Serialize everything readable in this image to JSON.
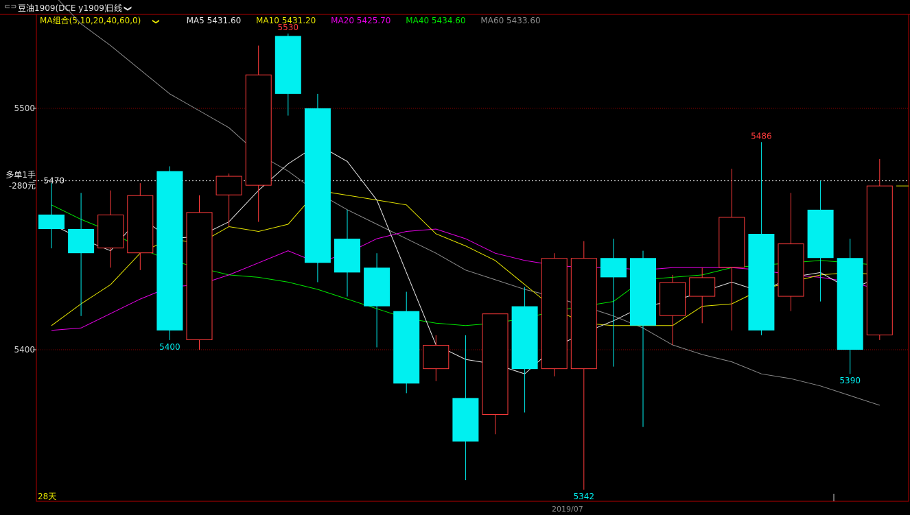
{
  "title_bar": {
    "symbol": "豆油1909(DCE y1909)",
    "period": "日线",
    "chevron": "❯"
  },
  "legend": {
    "group_label": "MA组合(5,10,20,40,60,0)",
    "items": [
      {
        "name": "MA5",
        "text": "MA5 5431.60",
        "color": "#e6e6e6"
      },
      {
        "name": "MA10",
        "text": "MA10 5431.20",
        "color": "#e6e600"
      },
      {
        "name": "MA20",
        "text": "MA20 5425.70",
        "color": "#e600e6"
      },
      {
        "name": "MA40",
        "text": "MA40 5434.60",
        "color": "#00e600"
      },
      {
        "name": "MA60",
        "text": "MA60 5433.60",
        "color": "#8c8c8c"
      }
    ]
  },
  "order": {
    "line1": "多单1手",
    "line2": "-280元",
    "price": "5470"
  },
  "days_label": "28天",
  "date_label": "2019/07",
  "colors": {
    "up": "#ff3b3b",
    "down": "#00f0f0",
    "grid": "#8c0000",
    "border": "#b40000"
  },
  "chart_data": {
    "type": "candlestick",
    "ylim": [
      5334,
      5560
    ],
    "y_ticks": [
      5400,
      5500
    ],
    "annotations": [
      {
        "text": "5530",
        "candle": 8,
        "at": "high"
      },
      {
        "text": "5400",
        "candle": 4,
        "at": "low"
      },
      {
        "text": "5342",
        "candle": 18,
        "at": "low"
      },
      {
        "text": "5486",
        "candle": 24,
        "at": "high"
      },
      {
        "text": "5390",
        "candle": 27,
        "at": "low"
      }
    ],
    "candles": [
      {
        "o": 5456,
        "h": 5469,
        "l": 5442,
        "c": 5450
      },
      {
        "o": 5450,
        "h": 5465,
        "l": 5414,
        "c": 5440
      },
      {
        "o": 5442,
        "h": 5466,
        "l": 5434,
        "c": 5456
      },
      {
        "o": 5440,
        "h": 5469,
        "l": 5433,
        "c": 5464
      },
      {
        "o": 5474,
        "h": 5476,
        "l": 5404,
        "c": 5408
      },
      {
        "o": 5404,
        "h": 5464,
        "l": 5400,
        "c": 5457
      },
      {
        "o": 5464,
        "h": 5473,
        "l": 5451,
        "c": 5472
      },
      {
        "o": 5468,
        "h": 5526,
        "l": 5453,
        "c": 5514
      },
      {
        "o": 5530,
        "h": 5531,
        "l": 5497,
        "c": 5506
      },
      {
        "o": 5500,
        "h": 5506,
        "l": 5428,
        "c": 5436
      },
      {
        "o": 5446,
        "h": 5458,
        "l": 5422,
        "c": 5432
      },
      {
        "o": 5434,
        "h": 5440,
        "l": 5401,
        "c": 5418
      },
      {
        "o": 5416,
        "h": 5424,
        "l": 5382,
        "c": 5386
      },
      {
        "o": 5392,
        "h": 5406,
        "l": 5387,
        "c": 5402
      },
      {
        "o": 5380,
        "h": 5406,
        "l": 5346,
        "c": 5362
      },
      {
        "o": 5373,
        "h": 5410,
        "l": 5365,
        "c": 5415
      },
      {
        "o": 5418,
        "h": 5426,
        "l": 5374,
        "c": 5392
      },
      {
        "o": 5392,
        "h": 5440,
        "l": 5389,
        "c": 5438
      },
      {
        "o": 5392,
        "h": 5445,
        "l": 5342,
        "c": 5438
      },
      {
        "o": 5438,
        "h": 5446,
        "l": 5393,
        "c": 5430
      },
      {
        "o": 5438,
        "h": 5441,
        "l": 5368,
        "c": 5410
      },
      {
        "o": 5414,
        "h": 5431,
        "l": 5402,
        "c": 5428
      },
      {
        "o": 5422,
        "h": 5434,
        "l": 5411,
        "c": 5430
      },
      {
        "o": 5434,
        "h": 5475,
        "l": 5408,
        "c": 5455
      },
      {
        "o": 5448,
        "h": 5486,
        "l": 5406,
        "c": 5408
      },
      {
        "o": 5422,
        "h": 5465,
        "l": 5416,
        "c": 5444
      },
      {
        "o": 5458,
        "h": 5470,
        "l": 5420,
        "c": 5438
      },
      {
        "o": 5438,
        "h": 5446,
        "l": 5390,
        "c": 5400
      },
      {
        "o": 5406,
        "h": 5479,
        "l": 5404,
        "c": 5468
      }
    ],
    "ma": {
      "MA5": [
        5452,
        5446,
        5441,
        5455,
        5446,
        5447,
        5453,
        5466,
        5477,
        5485,
        5478,
        5462,
        5432,
        5402,
        5396,
        5394,
        5390,
        5401,
        5407,
        5412,
        5418,
        5420,
        5424,
        5428,
        5424,
        5430,
        5432,
        5425,
        5430
      ],
      "MA10": [
        5410,
        5419,
        5427,
        5440,
        5446,
        5444,
        5451,
        5449,
        5452,
        5466,
        5464,
        5462,
        5460,
        5448,
        5443,
        5437,
        5427,
        5417,
        5411,
        5410,
        5410,
        5410,
        5418,
        5419,
        5425,
        5428,
        5431,
        5432,
        5431
      ],
      "MA20": [
        5408,
        5409,
        5415,
        5421,
        5426,
        5427,
        5431,
        5436,
        5441,
        5436,
        5440,
        5446,
        5449,
        5450,
        5446,
        5440,
        5437,
        5435,
        5434,
        5434,
        5433,
        5434,
        5434,
        5434,
        5433,
        5431,
        5430,
        5428,
        5425
      ],
      "MA40": [
        5460,
        5454,
        5449,
        5442,
        5437,
        5434,
        5431,
        5430,
        5428,
        5425,
        5421,
        5417,
        5413,
        5411,
        5410,
        5411,
        5413,
        5416,
        5418,
        5420,
        5429,
        5430,
        5431,
        5434,
        5435,
        5436,
        5437,
        5436,
        5435
      ],
      "MA60": [
        5548,
        5535,
        5526,
        5516,
        5506,
        5499,
        5492,
        5481,
        5474,
        5465,
        5458,
        5452,
        5446,
        5440,
        5433,
        5429,
        5425,
        5422,
        5418,
        5414,
        5409,
        5402,
        5398,
        5395,
        5390,
        5388,
        5385,
        5381,
        5377
      ]
    }
  }
}
